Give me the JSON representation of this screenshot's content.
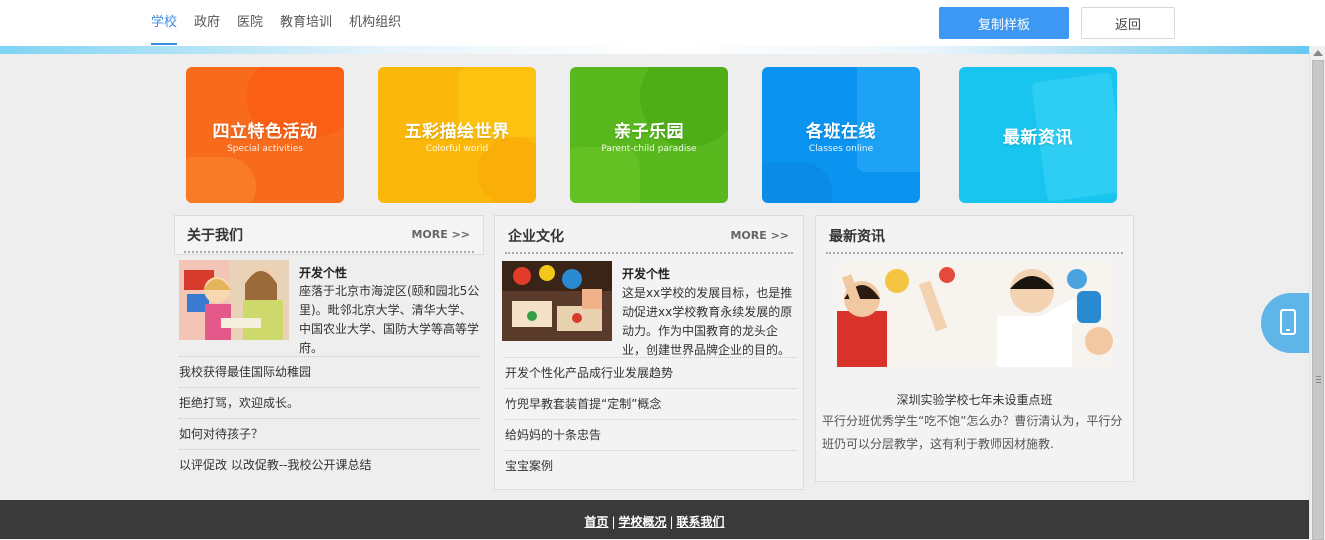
{
  "topbar": {
    "tabs": [
      {
        "label": "学校",
        "active": true
      },
      {
        "label": "政府",
        "active": false
      },
      {
        "label": "医院",
        "active": false
      },
      {
        "label": "教育培训",
        "active": false
      },
      {
        "label": "机构组织",
        "active": false
      }
    ],
    "copy_button": "复制样板",
    "back_button": "返回"
  },
  "tiles": [
    {
      "title": "四立特色活动",
      "subtitle": "Special activities",
      "color": "#f86b1c"
    },
    {
      "title": "五彩描绘世界",
      "subtitle": "Colorful world",
      "color": "#fbb80a"
    },
    {
      "title": "亲子乐园",
      "subtitle": "Parent-child paradise",
      "color": "#58b81d"
    },
    {
      "title": "各班在线",
      "subtitle": "Classes online",
      "color": "#0b93f0"
    },
    {
      "title": "最新资讯",
      "subtitle": "",
      "color": "#18c5ee"
    }
  ],
  "panels": {
    "about": {
      "title": "关于我们",
      "more": "MORE >>",
      "feature_title": "开发个性",
      "feature_text": "座落于北京市海淀区(颐和园北5公里)。毗邻北京大学、清华大学、中国农业大学、国防大学等高等学府。",
      "items": [
        "我校获得最佳国际幼稚园",
        "拒绝打骂，欢迎成长。",
        "如何对待孩子？",
        "以评促改 以改促教--我校公开课总结"
      ]
    },
    "culture": {
      "title": "企业文化",
      "more": "MORE >>",
      "feature_title": "开发个性",
      "feature_text": "这是xx学校的发展目标，也是推动促进xx学校教育永续发展的原动力。作为中国教育的龙头企业，创建世界品牌企业的目的。",
      "items": [
        "开发个性化产品成行业发展趋势",
        "竹兜早教套装首提“定制”概念",
        "给妈妈的十条忠告",
        "宝宝案例"
      ]
    },
    "news": {
      "title": "最新资讯",
      "caption": "深圳实验学校七年未设重点班",
      "text": "平行分班优秀学生“吃不饱”怎么办？曹衍清认为，平行分班仍可以分层教学，这有利于教师因材施教."
    }
  },
  "footer": {
    "links": [
      "首页",
      "学校概况",
      "联系我们"
    ]
  },
  "colors": {
    "accent": "#3c98f2",
    "footer_bg": "#3a3a3a",
    "page_bg": "#eeeeee"
  },
  "icons": {
    "side_widget": "mobile-phone-icon",
    "more_arrow": "double-chevron-right-icon"
  }
}
